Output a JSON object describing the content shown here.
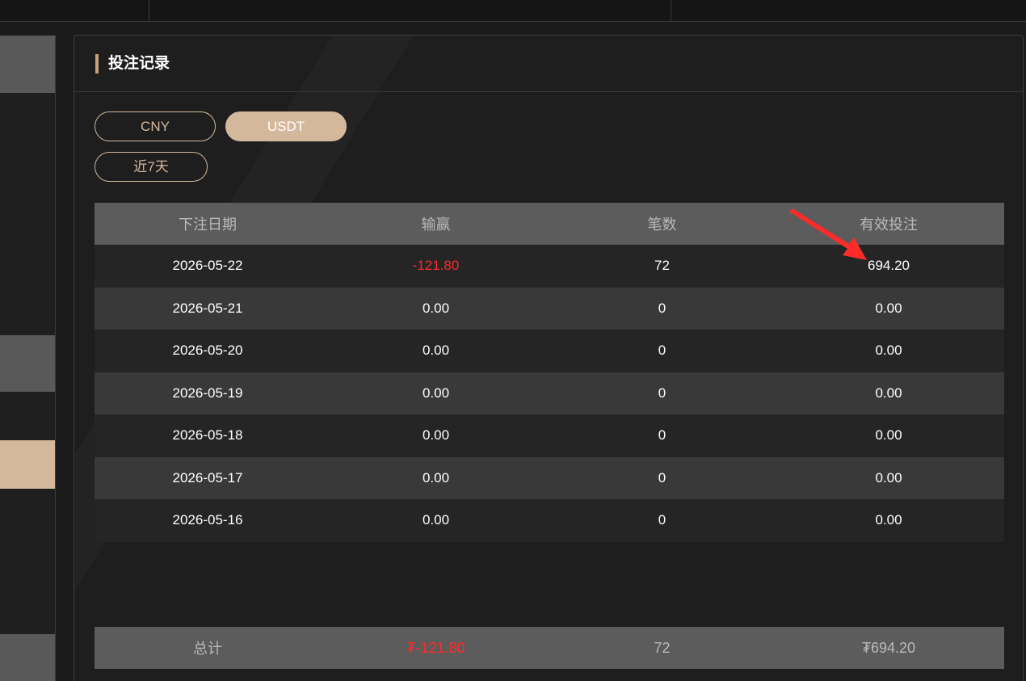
{
  "page_title": "投注记录",
  "currency_tabs": [
    {
      "label": "CNY",
      "active": false
    },
    {
      "label": "USDT",
      "active": true
    }
  ],
  "period_filter": {
    "label": "近7天"
  },
  "table": {
    "headers": [
      "下注日期",
      "输赢",
      "笔数",
      "有效投注"
    ],
    "rows": [
      {
        "date": "2026-05-22",
        "win_loss": "-121.80",
        "count": "72",
        "valid_bet": "694.20",
        "negative": true
      },
      {
        "date": "2026-05-21",
        "win_loss": "0.00",
        "count": "0",
        "valid_bet": "0.00",
        "negative": false
      },
      {
        "date": "2026-05-20",
        "win_loss": "0.00",
        "count": "0",
        "valid_bet": "0.00",
        "negative": false
      },
      {
        "date": "2026-05-19",
        "win_loss": "0.00",
        "count": "0",
        "valid_bet": "0.00",
        "negative": false
      },
      {
        "date": "2026-05-18",
        "win_loss": "0.00",
        "count": "0",
        "valid_bet": "0.00",
        "negative": false
      },
      {
        "date": "2026-05-17",
        "win_loss": "0.00",
        "count": "0",
        "valid_bet": "0.00",
        "negative": false
      },
      {
        "date": "2026-05-16",
        "win_loss": "0.00",
        "count": "0",
        "valid_bet": "0.00",
        "negative": false
      }
    ],
    "total": {
      "label": "总计",
      "win_loss": "₮-121.80",
      "count": "72",
      "valid_bet": "₮694.20"
    }
  },
  "colors": {
    "accent": "#d4b89c",
    "negative": "#ff2a2a",
    "header_bg": "#5c5c5c",
    "annotation_arrow": "#ff2b2b"
  }
}
